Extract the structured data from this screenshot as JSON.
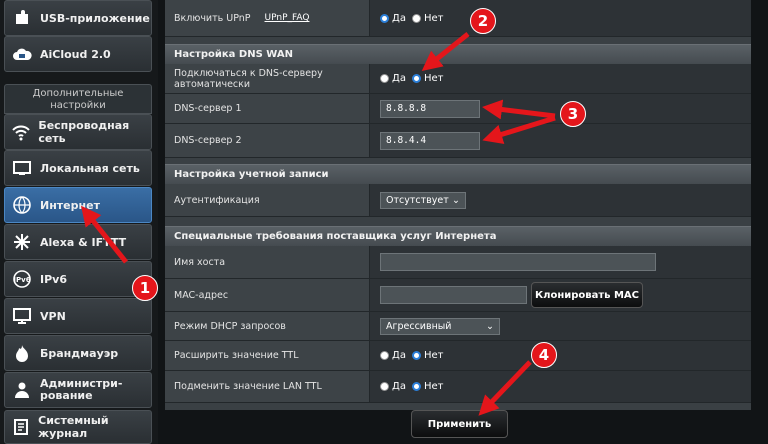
{
  "sidebar": {
    "items_top": [
      {
        "label": "USB-приложение",
        "icon": "usb-puzzle-icon"
      },
      {
        "label": "AiCloud 2.0",
        "icon": "cloud-icon"
      }
    ],
    "section_header": "Дополнительные настройки",
    "items": [
      {
        "label": "Беспроводная сеть",
        "icon": "wifi-icon"
      },
      {
        "label": "Локальная сеть",
        "icon": "home-icon"
      },
      {
        "label": "Интернет",
        "icon": "globe-icon"
      },
      {
        "label": "Alexa & IFTTT",
        "icon": "alexa-icon"
      },
      {
        "label": "IPv6",
        "icon": "ipv6-icon"
      },
      {
        "label": "VPN",
        "icon": "vpn-icon"
      },
      {
        "label": "Брандмауэр",
        "icon": "firewall-icon"
      },
      {
        "label": "Администри-рование",
        "icon": "admin-icon"
      },
      {
        "label": "Системный журнал",
        "icon": "log-icon"
      }
    ]
  },
  "upnp": {
    "label": "Включить UPnP",
    "faq": "UPnP_FAQ",
    "yes": "Да",
    "no": "Нет"
  },
  "dns_section": {
    "title": "Настройка DNS WAN",
    "auto_label": "Подключаться к DNS-серверу автоматически",
    "yes": "Да",
    "no": "Нет",
    "dns1_label": "DNS-сервер 1",
    "dns1_value": "8.8.8.8",
    "dns2_label": "DNS-сервер 2",
    "dns2_value": "8.8.4.4"
  },
  "account_section": {
    "title": "Настройка учетной записи",
    "auth_label": "Аутентификация",
    "auth_value": "Отсутствует"
  },
  "isp_section": {
    "title": "Специальные требования поставщика услуг Интернета",
    "host_label": "Имя хоста",
    "host_value": "",
    "mac_label": "MAC-адрес",
    "mac_value": "",
    "clone_mac": "Клонировать MAC",
    "dhcp_label": "Режим DHCP запросов",
    "dhcp_value": "Агрессивный",
    "ttl_label": "Расширить значение TTL",
    "lan_ttl_label": "Подменить значение LAN TTL",
    "yes": "Да",
    "no": "Нет"
  },
  "apply_button": "Применить",
  "annotations": {
    "b1": "1",
    "b2": "2",
    "b3": "3",
    "b4": "4",
    "color": "#e4161b"
  }
}
